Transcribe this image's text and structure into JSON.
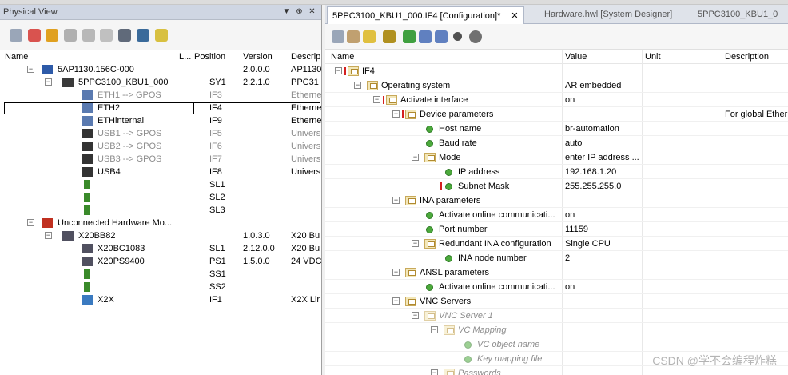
{
  "left_panel": {
    "title": "Physical View",
    "pin_glyph": "▼",
    "pin2_glyph": "⊕",
    "close_glyph": "✕",
    "columns": {
      "name": "Name",
      "l": "L...",
      "position": "Position",
      "version": "Version",
      "description": "Descrip"
    },
    "rows": [
      {
        "name": "5AP1130.156C-000",
        "position": "",
        "version": "2.0.0.0",
        "desc": "AP1130",
        "icon": "monitor-icon",
        "gray": false
      },
      {
        "name": "5PPC3100_KBU1_000",
        "position": "SY1",
        "version": "2.2.1.0",
        "desc": "PPC31",
        "icon": "device-icon",
        "gray": false
      },
      {
        "name": "ETH1 --> GPOS",
        "position": "IF3",
        "version": "",
        "desc": "Etherne",
        "icon": "network-icon",
        "gray": true
      },
      {
        "name": "ETH2",
        "position": "IF4",
        "version": "",
        "desc": "Etherne",
        "icon": "network-icon",
        "gray": false
      },
      {
        "name": "ETHinternal",
        "position": "IF9",
        "version": "",
        "desc": "Etherne",
        "icon": "network-icon",
        "gray": false
      },
      {
        "name": "USB1 --> GPOS",
        "position": "IF5",
        "version": "",
        "desc": "Univers",
        "icon": "usb-icon",
        "gray": true
      },
      {
        "name": "USB2 --> GPOS",
        "position": "IF6",
        "version": "",
        "desc": "Univers",
        "icon": "usb-icon",
        "gray": true
      },
      {
        "name": "USB3 --> GPOS",
        "position": "IF7",
        "version": "",
        "desc": "Univers",
        "icon": "usb-icon",
        "gray": true
      },
      {
        "name": "USB4",
        "position": "IF8",
        "version": "",
        "desc": "Univers",
        "icon": "usb-icon",
        "gray": false
      },
      {
        "name": "",
        "position": "SL1",
        "version": "",
        "desc": "",
        "icon": "slot-icon",
        "gray": false
      },
      {
        "name": "",
        "position": "SL2",
        "version": "",
        "desc": "",
        "icon": "slot-icon",
        "gray": false
      },
      {
        "name": "",
        "position": "SL3",
        "version": "",
        "desc": "",
        "icon": "slot-icon",
        "gray": false
      },
      {
        "name": "Unconnected Hardware Mo...",
        "position": "",
        "version": "",
        "desc": "",
        "icon": "unconnected-icon",
        "gray": false
      },
      {
        "name": "X20BB82",
        "position": "",
        "version": "1.0.3.0",
        "desc": "X20 Bu",
        "icon": "module-icon",
        "gray": false
      },
      {
        "name": "X20BC1083",
        "position": "SL1",
        "version": "2.12.0.0",
        "desc": "X20 Bu",
        "icon": "module-icon",
        "gray": false
      },
      {
        "name": "X20PS9400",
        "position": "PS1",
        "version": "1.5.0.0",
        "desc": "24 VDC",
        "icon": "module-icon",
        "gray": false
      },
      {
        "name": "",
        "position": "SS1",
        "version": "",
        "desc": "",
        "icon": "slot-icon",
        "gray": false
      },
      {
        "name": "",
        "position": "SS2",
        "version": "",
        "desc": "",
        "icon": "slot-icon",
        "gray": false
      },
      {
        "name": "X2X",
        "position": "IF1",
        "version": "",
        "desc": "X2X Lir",
        "icon": "x2x-icon",
        "gray": false
      }
    ]
  },
  "right_panel": {
    "tabs": [
      {
        "label": "5PPC3100_KBU1_000.IF4 [Configuration]*",
        "active": true
      },
      {
        "label": "Hardware.hwl [System Designer]",
        "active": false
      },
      {
        "label": "5PPC3100_KBU1_0",
        "active": false
      }
    ],
    "tab_close": "✕",
    "columns": {
      "name": "Name",
      "value": "Value",
      "unit": "Unit",
      "description": "Description"
    },
    "rows": [
      {
        "name": "IF4",
        "value": "",
        "desc": "",
        "level": 0,
        "kind": "folder",
        "italic": false,
        "red": true
      },
      {
        "name": "Operating system",
        "value": "AR embedded",
        "desc": "",
        "level": 1,
        "kind": "folder",
        "italic": false,
        "red": false
      },
      {
        "name": "Activate interface",
        "value": "on",
        "desc": "",
        "level": 2,
        "kind": "folder",
        "italic": false,
        "red": true
      },
      {
        "name": "Device parameters",
        "value": "",
        "desc": "For global Ethern",
        "level": 3,
        "kind": "folder",
        "italic": false,
        "red": true
      },
      {
        "name": "Host name",
        "value": "br-automation",
        "desc": "",
        "level": 4,
        "kind": "leaf",
        "italic": false,
        "red": false
      },
      {
        "name": "Baud rate",
        "value": "auto",
        "desc": "",
        "level": 4,
        "kind": "leaf",
        "italic": false,
        "red": false
      },
      {
        "name": "Mode",
        "value": "enter IP address ...",
        "desc": "",
        "level": 4,
        "kind": "folder",
        "italic": false,
        "red": false
      },
      {
        "name": "IP address",
        "value": "192.168.1.20",
        "desc": "",
        "level": 5,
        "kind": "leaf",
        "italic": false,
        "red": false
      },
      {
        "name": "Subnet Mask",
        "value": "255.255.255.0",
        "desc": "",
        "level": 5,
        "kind": "leaf",
        "italic": false,
        "red": true
      },
      {
        "name": "INA parameters",
        "value": "",
        "desc": "",
        "level": 3,
        "kind": "folder",
        "italic": false,
        "red": false
      },
      {
        "name": "Activate online communicati...",
        "value": "on",
        "desc": "",
        "level": 4,
        "kind": "leaf",
        "italic": false,
        "red": false
      },
      {
        "name": "Port number",
        "value": "11159",
        "desc": "",
        "level": 4,
        "kind": "leaf",
        "italic": false,
        "red": false
      },
      {
        "name": "Redundant INA configuration",
        "value": "Single CPU",
        "desc": "",
        "level": 4,
        "kind": "folder",
        "italic": false,
        "red": false
      },
      {
        "name": "INA node number",
        "value": "2",
        "desc": "",
        "level": 5,
        "kind": "leaf",
        "italic": false,
        "red": false
      },
      {
        "name": "ANSL parameters",
        "value": "",
        "desc": "",
        "level": 3,
        "kind": "folder",
        "italic": false,
        "red": false
      },
      {
        "name": "Activate online communicati...",
        "value": "on",
        "desc": "",
        "level": 4,
        "kind": "leaf",
        "italic": false,
        "red": false
      },
      {
        "name": "VNC Servers",
        "value": "",
        "desc": "",
        "level": 3,
        "kind": "folder",
        "italic": false,
        "red": false
      },
      {
        "name": "VNC Server 1",
        "value": "",
        "desc": "",
        "level": 4,
        "kind": "folder",
        "italic": true,
        "red": false
      },
      {
        "name": "VC Mapping",
        "value": "",
        "desc": "",
        "level": 5,
        "kind": "folder",
        "italic": true,
        "red": false
      },
      {
        "name": "VC object name",
        "value": "",
        "desc": "",
        "level": 6,
        "kind": "leaf",
        "italic": true,
        "red": false
      },
      {
        "name": "Key mapping file",
        "value": "",
        "desc": "",
        "level": 6,
        "kind": "leaf",
        "italic": true,
        "red": false
      },
      {
        "name": "Passwords",
        "value": "",
        "desc": "",
        "level": 5,
        "kind": "folder",
        "italic": true,
        "red": false
      }
    ]
  },
  "watermark": "CSDN @学不会编程炸糕",
  "colors": {
    "selection_border": "#000000",
    "title_bg": "#cfd6e3",
    "leaf_green": "#4caa3c",
    "required_red": "#d42020"
  }
}
